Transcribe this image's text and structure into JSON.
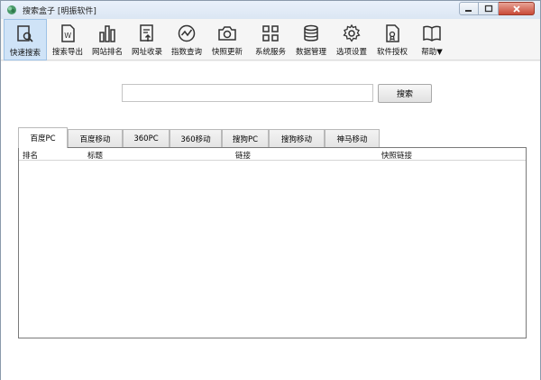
{
  "window": {
    "title": "搜索盒子 [明振软件]"
  },
  "toolbar": {
    "items": [
      {
        "label": "快速搜索",
        "icon": "quick-search-icon"
      },
      {
        "label": "搜索导出",
        "icon": "export-word-icon"
      },
      {
        "label": "网站排名",
        "icon": "ranking-bars-icon"
      },
      {
        "label": "网址收录",
        "icon": "url-index-icon"
      },
      {
        "label": "指数查询",
        "icon": "index-trend-icon"
      },
      {
        "label": "快照更新",
        "icon": "camera-icon"
      },
      {
        "label": "系统服务",
        "icon": "grid-icon"
      },
      {
        "label": "数据管理",
        "icon": "database-icon"
      },
      {
        "label": "选项设置",
        "icon": "gear-icon"
      },
      {
        "label": "软件授权",
        "icon": "license-icon"
      },
      {
        "label": "帮助▼",
        "icon": "help-book-icon"
      }
    ]
  },
  "search": {
    "value": "",
    "placeholder": "",
    "button_label": "搜索"
  },
  "tabs": [
    {
      "label": "百度PC",
      "active": true
    },
    {
      "label": "百度移动",
      "active": false
    },
    {
      "label": "360PC",
      "active": false
    },
    {
      "label": "360移动",
      "active": false
    },
    {
      "label": "搜狗PC",
      "active": false
    },
    {
      "label": "搜狗移动",
      "active": false
    },
    {
      "label": "神马移动",
      "active": false
    }
  ],
  "table": {
    "columns": [
      "排名",
      "标题",
      "链接",
      "快照链接"
    ],
    "rows": []
  },
  "colors": {
    "active_tab_bg": "#ffffff",
    "toolbar_active": "#cfe3f7",
    "close_button": "#c94a38"
  }
}
